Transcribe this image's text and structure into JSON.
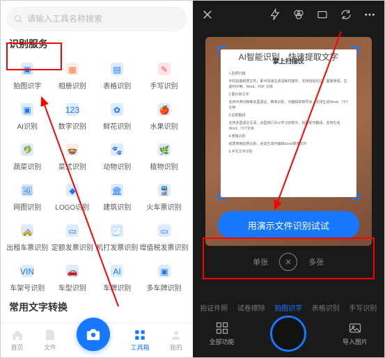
{
  "left": {
    "search_placeholder": "请输入工具名称搜索",
    "section_title": "识别服务",
    "section2_title": "常用文字转换",
    "items": [
      {
        "label": "拍图识字",
        "color": "#1677ff"
      },
      {
        "label": "相册识别",
        "color": "#ff7a45"
      },
      {
        "label": "表格识别",
        "color": "#1677ff"
      },
      {
        "label": "手写识别",
        "color": "#ff4d4f"
      },
      {
        "label": "AI识别",
        "color": "#1677ff"
      },
      {
        "label": "数字识别",
        "color": "#1677ff"
      },
      {
        "label": "鲜花识别",
        "color": "#1677ff"
      },
      {
        "label": "水果识别",
        "color": "#1677ff"
      },
      {
        "label": "蔬菜识别",
        "color": "#1677ff"
      },
      {
        "label": "菜式识别",
        "color": "#ff7a45"
      },
      {
        "label": "动物识别",
        "color": "#1677ff"
      },
      {
        "label": "植物识别",
        "color": "#1677ff"
      },
      {
        "label": "网图识别",
        "color": "#1677ff"
      },
      {
        "label": "LOGO识别",
        "color": "#1677ff"
      },
      {
        "label": "建筑识别",
        "color": "#1677ff"
      },
      {
        "label": "火车票识别",
        "color": "#1677ff"
      },
      {
        "label": "出租车票识别",
        "color": "#1677ff"
      },
      {
        "label": "定额发票识别",
        "color": "#1677ff"
      },
      {
        "label": "机打发票识别",
        "color": "#1677ff"
      },
      {
        "label": "增值税发票识别",
        "color": "#1677ff"
      },
      {
        "label": "车架号识别",
        "color": "#1677ff"
      },
      {
        "label": "车型识别",
        "color": "#1677ff"
      },
      {
        "label": "车牌识别",
        "color": "#1677ff"
      },
      {
        "label": "多车牌识别",
        "color": "#1677ff"
      }
    ],
    "nav": {
      "home": "首页",
      "files": "文件",
      "tools": "工具箱",
      "me": "我的"
    }
  },
  "right": {
    "banner": "AI智能识别，快速提取文字",
    "doc_title": "掌上扫描仪",
    "demo_btn": "用演示文件识别试试",
    "mode_single": "单张",
    "mode_multi": "多张",
    "fn_tabs": [
      "拍证件照",
      "试卷擦除",
      "拍图识字",
      "表格识别",
      "手写识别"
    ],
    "fn_active": 2,
    "bottom_left": "全部功能",
    "bottom_right": "导入图片"
  }
}
